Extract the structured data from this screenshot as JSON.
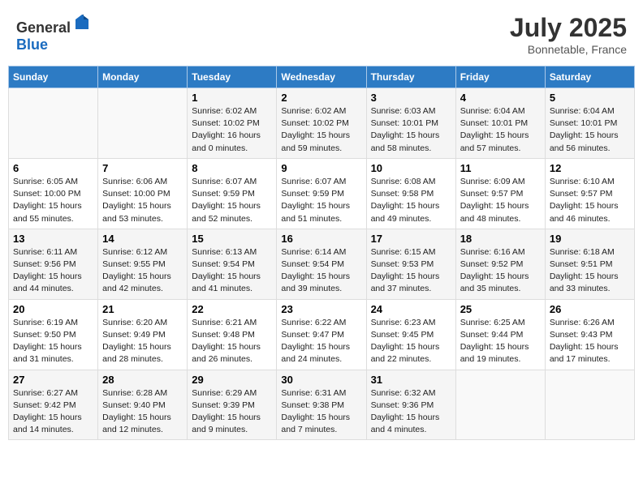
{
  "header": {
    "logo_general": "General",
    "logo_blue": "Blue",
    "month_year": "July 2025",
    "location": "Bonnetable, France"
  },
  "weekdays": [
    "Sunday",
    "Monday",
    "Tuesday",
    "Wednesday",
    "Thursday",
    "Friday",
    "Saturday"
  ],
  "weeks": [
    [
      {
        "day": "",
        "info": ""
      },
      {
        "day": "",
        "info": ""
      },
      {
        "day": "1",
        "info": "Sunrise: 6:02 AM\nSunset: 10:02 PM\nDaylight: 16 hours\nand 0 minutes."
      },
      {
        "day": "2",
        "info": "Sunrise: 6:02 AM\nSunset: 10:02 PM\nDaylight: 15 hours\nand 59 minutes."
      },
      {
        "day": "3",
        "info": "Sunrise: 6:03 AM\nSunset: 10:01 PM\nDaylight: 15 hours\nand 58 minutes."
      },
      {
        "day": "4",
        "info": "Sunrise: 6:04 AM\nSunset: 10:01 PM\nDaylight: 15 hours\nand 57 minutes."
      },
      {
        "day": "5",
        "info": "Sunrise: 6:04 AM\nSunset: 10:01 PM\nDaylight: 15 hours\nand 56 minutes."
      }
    ],
    [
      {
        "day": "6",
        "info": "Sunrise: 6:05 AM\nSunset: 10:00 PM\nDaylight: 15 hours\nand 55 minutes."
      },
      {
        "day": "7",
        "info": "Sunrise: 6:06 AM\nSunset: 10:00 PM\nDaylight: 15 hours\nand 53 minutes."
      },
      {
        "day": "8",
        "info": "Sunrise: 6:07 AM\nSunset: 9:59 PM\nDaylight: 15 hours\nand 52 minutes."
      },
      {
        "day": "9",
        "info": "Sunrise: 6:07 AM\nSunset: 9:59 PM\nDaylight: 15 hours\nand 51 minutes."
      },
      {
        "day": "10",
        "info": "Sunrise: 6:08 AM\nSunset: 9:58 PM\nDaylight: 15 hours\nand 49 minutes."
      },
      {
        "day": "11",
        "info": "Sunrise: 6:09 AM\nSunset: 9:57 PM\nDaylight: 15 hours\nand 48 minutes."
      },
      {
        "day": "12",
        "info": "Sunrise: 6:10 AM\nSunset: 9:57 PM\nDaylight: 15 hours\nand 46 minutes."
      }
    ],
    [
      {
        "day": "13",
        "info": "Sunrise: 6:11 AM\nSunset: 9:56 PM\nDaylight: 15 hours\nand 44 minutes."
      },
      {
        "day": "14",
        "info": "Sunrise: 6:12 AM\nSunset: 9:55 PM\nDaylight: 15 hours\nand 42 minutes."
      },
      {
        "day": "15",
        "info": "Sunrise: 6:13 AM\nSunset: 9:54 PM\nDaylight: 15 hours\nand 41 minutes."
      },
      {
        "day": "16",
        "info": "Sunrise: 6:14 AM\nSunset: 9:54 PM\nDaylight: 15 hours\nand 39 minutes."
      },
      {
        "day": "17",
        "info": "Sunrise: 6:15 AM\nSunset: 9:53 PM\nDaylight: 15 hours\nand 37 minutes."
      },
      {
        "day": "18",
        "info": "Sunrise: 6:16 AM\nSunset: 9:52 PM\nDaylight: 15 hours\nand 35 minutes."
      },
      {
        "day": "19",
        "info": "Sunrise: 6:18 AM\nSunset: 9:51 PM\nDaylight: 15 hours\nand 33 minutes."
      }
    ],
    [
      {
        "day": "20",
        "info": "Sunrise: 6:19 AM\nSunset: 9:50 PM\nDaylight: 15 hours\nand 31 minutes."
      },
      {
        "day": "21",
        "info": "Sunrise: 6:20 AM\nSunset: 9:49 PM\nDaylight: 15 hours\nand 28 minutes."
      },
      {
        "day": "22",
        "info": "Sunrise: 6:21 AM\nSunset: 9:48 PM\nDaylight: 15 hours\nand 26 minutes."
      },
      {
        "day": "23",
        "info": "Sunrise: 6:22 AM\nSunset: 9:47 PM\nDaylight: 15 hours\nand 24 minutes."
      },
      {
        "day": "24",
        "info": "Sunrise: 6:23 AM\nSunset: 9:45 PM\nDaylight: 15 hours\nand 22 minutes."
      },
      {
        "day": "25",
        "info": "Sunrise: 6:25 AM\nSunset: 9:44 PM\nDaylight: 15 hours\nand 19 minutes."
      },
      {
        "day": "26",
        "info": "Sunrise: 6:26 AM\nSunset: 9:43 PM\nDaylight: 15 hours\nand 17 minutes."
      }
    ],
    [
      {
        "day": "27",
        "info": "Sunrise: 6:27 AM\nSunset: 9:42 PM\nDaylight: 15 hours\nand 14 minutes."
      },
      {
        "day": "28",
        "info": "Sunrise: 6:28 AM\nSunset: 9:40 PM\nDaylight: 15 hours\nand 12 minutes."
      },
      {
        "day": "29",
        "info": "Sunrise: 6:29 AM\nSunset: 9:39 PM\nDaylight: 15 hours\nand 9 minutes."
      },
      {
        "day": "30",
        "info": "Sunrise: 6:31 AM\nSunset: 9:38 PM\nDaylight: 15 hours\nand 7 minutes."
      },
      {
        "day": "31",
        "info": "Sunrise: 6:32 AM\nSunset: 9:36 PM\nDaylight: 15 hours\nand 4 minutes."
      },
      {
        "day": "",
        "info": ""
      },
      {
        "day": "",
        "info": ""
      }
    ]
  ]
}
